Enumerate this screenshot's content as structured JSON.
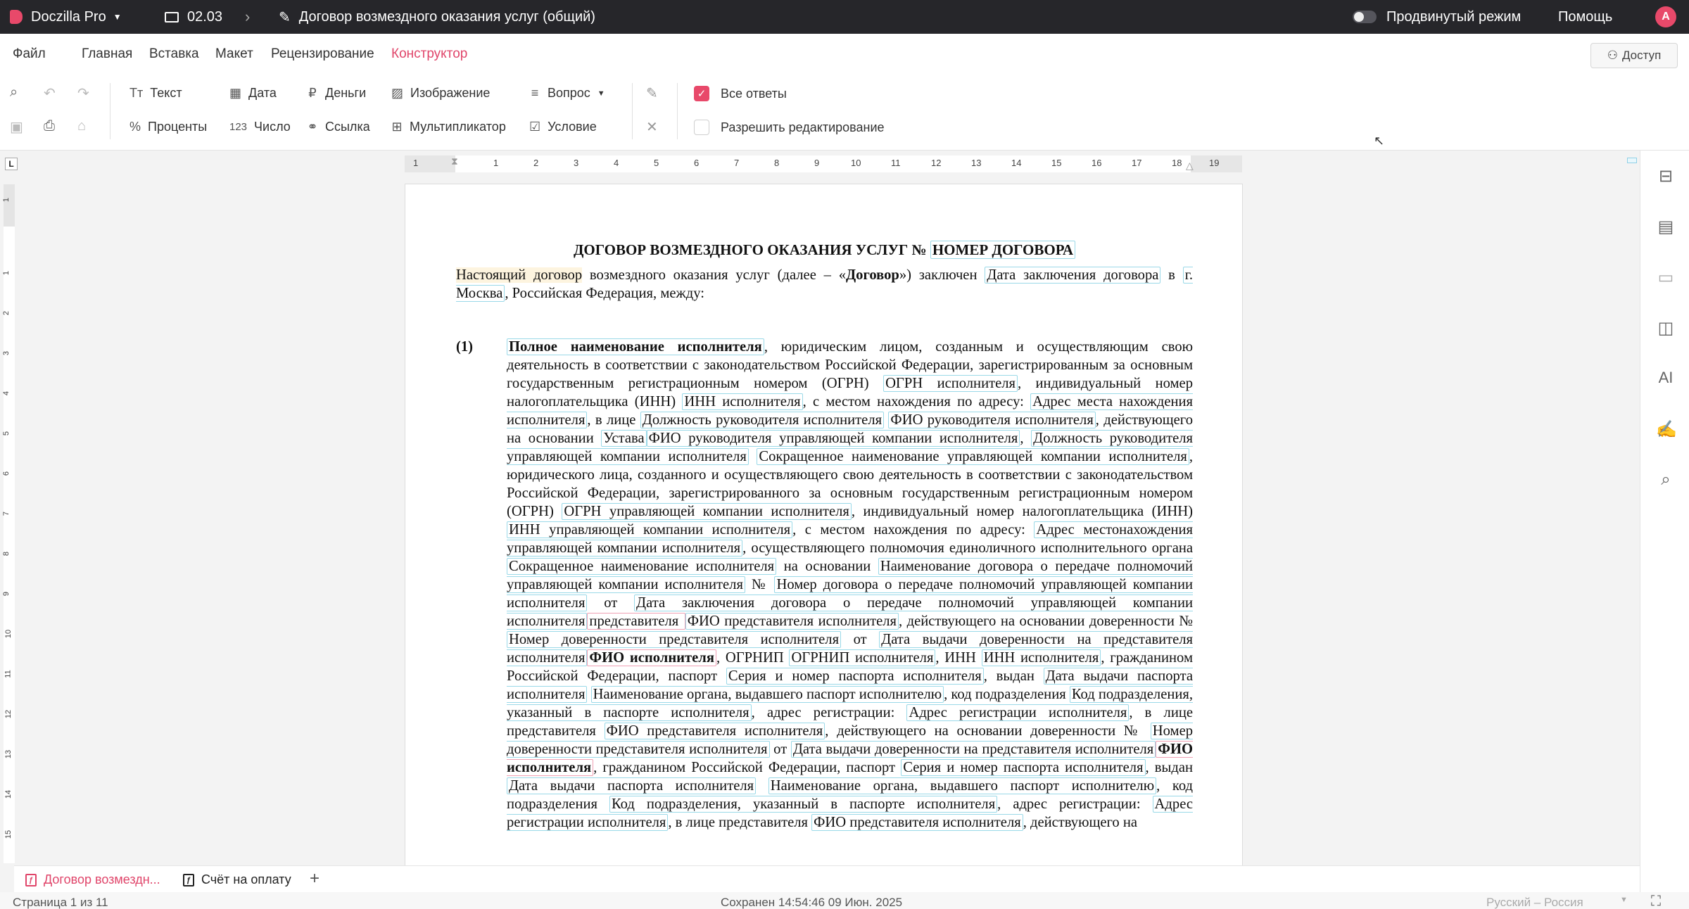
{
  "topbar": {
    "app_name": "Doczilla Pro",
    "folder": "02.03",
    "document_title": "Договор возмездного оказания услуг (общий)",
    "advanced_mode_label": "Продвинутый режим",
    "help_label": "Помощь",
    "avatar_letter": "А"
  },
  "menu": {
    "items": [
      "Файл",
      "Главная",
      "Вставка",
      "Макет",
      "Рецензирование",
      "Конструктор"
    ],
    "active": "Конструктор",
    "access_label": "Доступ"
  },
  "toolbar": {
    "text": "Текст",
    "date": "Дата",
    "money": "Деньги",
    "image": "Изображение",
    "question": "Вопрос",
    "percent": "Проценты",
    "number": "Число",
    "number_prefix": "123",
    "link": "Ссылка",
    "multiplier": "Мультипликатор",
    "condition": "Условие",
    "all_answers": "Все ответы",
    "allow_editing": "Разрешить редактирование"
  },
  "ruler": {
    "h_numbers": [
      "1",
      "1",
      "2",
      "3",
      "4",
      "5",
      "6",
      "7",
      "8",
      "9",
      "10",
      "11",
      "12",
      "13",
      "14",
      "15",
      "16",
      "17",
      "18",
      "19"
    ],
    "v_numbers": [
      "1",
      "1",
      "2",
      "3",
      "4",
      "5",
      "6",
      "7",
      "8",
      "9",
      "10",
      "11",
      "12",
      "13",
      "14",
      "15"
    ]
  },
  "doc": {
    "title_prefix": "ДОГОВОР ВОЗМЕЗДНОГО ОКАЗАНИЯ УСЛУГ №",
    "title_field": "НОМЕР ДОГОВОРА",
    "intro": {
      "a": "Настоящий договор",
      "b": " возмездного оказания услуг (далее – «",
      "c": "Договор",
      "d": "») заключен ",
      "e": "Дата заключения договора",
      "f": " в ",
      "g": "г. Москва",
      "h": ", Российская Федерация, между:"
    },
    "para1_label": "(1)",
    "para1": {
      "s1": "Полное наименование исполнителя",
      "t1": ", юридическим лицом, созданным и осуществляющим свою деятельность в соответствии с законодательством Российской Федерации, зарегистрированным за основным государственным регистрационным номером (ОГРН) ",
      "s2": "ОГРН исполнителя",
      "t2": ", индивидуальный номер налогоплательщика (ИНН) ",
      "s3": "ИНН исполнителя",
      "t3": ", с местом нахождения по адресу: ",
      "s4": "Адрес места нахождения исполнителя",
      "t4": ", в лице ",
      "s5": "Должность руководителя исполнителя",
      "t5": " ",
      "s6": "ФИО руководителя исполнителя",
      "t6": ", действующего на основании ",
      "s7": "Устава",
      "s8": "ФИО руководителя управляющей компании исполнителя",
      "t8": ", ",
      "s9": "Должность руководителя управляющей компании исполнителя",
      "t9": " ",
      "s10": "Сокращенное наименование управляющей компании исполнителя",
      "t10": ", юридического лица, созданного и осуществляющего свою деятельность в соответствии с законодательством Российской Федерации, зарегистрированного за основным государственным регистрационным номером (ОГРН) ",
      "s11": "ОГРН управляющей компании исполнителя",
      "t11": ", индивидуальный номер налогоплательщика (ИНН) ",
      "s12": "ИНН управляющей компании исполнителя",
      "t12": ", с местом нахождения по адресу: ",
      "s13": "Адрес местонахождения управляющей компании исполнителя",
      "t13": ", осуществляющего полномочия единоличного исполнительного органа ",
      "s14": "Сокращенное наименование исполнителя",
      "t14": " на основании ",
      "s15": "Наименование договора о передаче полномочий управляющей компании исполнителя",
      "t15": " № ",
      "s16": "Номер договора о передаче полномочий управляющей компании исполнителя",
      "t16": " от ",
      "s17": "Дата заключения договора о передаче полномочий управляющей компании исполнителя",
      "s18": "представителя ",
      "s19": "ФИО представителя исполнителя",
      "t19": ", действующего на основании доверенности № ",
      "s20": "Номер доверенности представителя исполнителя",
      "t20": " от ",
      "s21": "Дата выдачи доверенности на представителя исполнителя",
      "s22": "ФИО исполнителя",
      "t22": ", ОГРНИП ",
      "s23": "ОГРНИП исполнителя",
      "t23": ", ИНН ",
      "s24": "ИНН исполнителя",
      "t24": ", гражданином Российской Федерации, паспорт ",
      "s25": "Серия и номер паспорта исполнителя",
      "t25": ", выдан ",
      "s26": "Дата выдачи паспорта исполнителя",
      "t26": " ",
      "s27": "Наименование органа, выдавшего паспорт исполнителю",
      "t27": ", код подразделения ",
      "s28": "Код подразделения, указанный в паспорте исполнителя",
      "t28": ", адрес регистрации: ",
      "s29": "Адрес регистрации исполнителя",
      "t29": ", в лице представителя ",
      "s30": "ФИО представителя исполнителя",
      "t30": ", действующего на основании доверенности № ",
      "s31": "Номер доверенности представителя исполнителя",
      "t31": " от ",
      "s32": "Дата выдачи доверенности на представителя исполнителя",
      "s33": "ФИО исполнителя",
      "t33": ", гражданином Российской Федерации, паспорт ",
      "s34": "Серия и номер паспорта исполнителя",
      "t34": ", выдан ",
      "s35": "Дата выдачи паспорта исполнителя",
      "t35": " ",
      "s36": "Наименование органа, выдавшего паспорт исполнителю",
      "t36": ", код подразделения ",
      "s37": "Код подразделения, указанный в паспорте исполнителя",
      "t37": ", адрес регистрации: ",
      "s38": "Адрес регистрации исполнителя",
      "t38": ", в лице представителя ",
      "s39": "ФИО представителя исполнителя",
      "t39": ", действующего на"
    }
  },
  "tabs": {
    "tab1": "Договор возмездн...",
    "tab2": "Счёт на оплату"
  },
  "status": {
    "page": "Страница 1 из 11",
    "saved": "Сохранен 14:54:46 09 Июн. 2025",
    "language": "Русский – Россия"
  },
  "colors": {
    "accent": "#e8496a",
    "topbar_bg": "#26262a",
    "field_border": "#9ad9e8"
  }
}
